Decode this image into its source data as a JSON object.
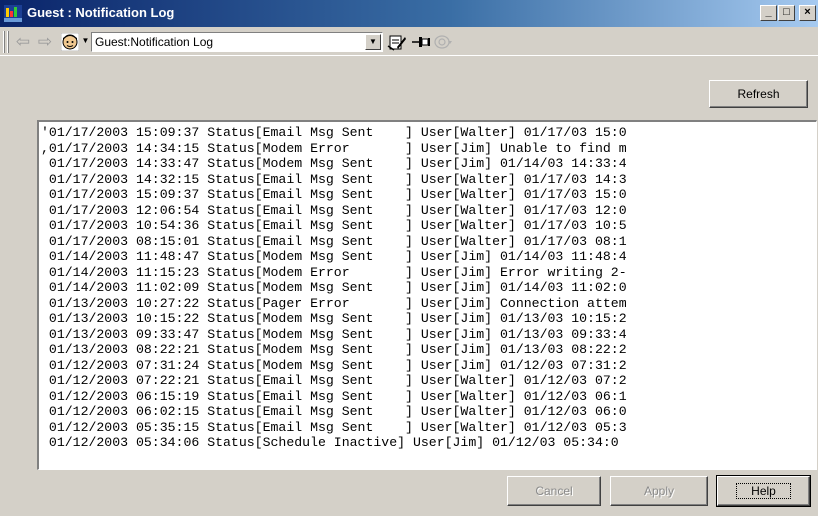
{
  "window": {
    "title": "Guest : Notification Log",
    "minimize_glyph": "_",
    "maximize_glyph": "□",
    "close_glyph": "×"
  },
  "toolbar": {
    "back_icon": "back-arrow-icon",
    "forward_icon": "forward-arrow-icon",
    "address_value": "Guest:Notification Log",
    "back_glyph": "⇦",
    "forward_glyph": "⇨",
    "dropdown_glyph": "▼"
  },
  "actions": {
    "refresh_label": "Refresh",
    "cancel_label": "Cancel",
    "apply_label": "Apply",
    "help_label": "Help"
  },
  "log": {
    "lines": [
      "'01/17/2003 15:09:37 Status[Email Msg Sent    ] User[Walter] 01/17/03 15:0",
      ",01/17/2003 14:34:15 Status[Modem Error       ] User[Jim] Unable to find m",
      " 01/17/2003 14:33:47 Status[Modem Msg Sent    ] User[Jim] 01/14/03 14:33:4",
      " 01/17/2003 14:32:15 Status[Email Msg Sent    ] User[Walter] 01/17/03 14:3",
      " 01/17/2003 15:09:37 Status[Email Msg Sent    ] User[Walter] 01/17/03 15:0",
      " 01/17/2003 12:06:54 Status[Email Msg Sent    ] User[Walter] 01/17/03 12:0",
      " 01/17/2003 10:54:36 Status[Email Msg Sent    ] User[Walter] 01/17/03 10:5",
      " 01/17/2003 08:15:01 Status[Email Msg Sent    ] User[Walter] 01/17/03 08:1",
      " 01/14/2003 11:48:47 Status[Modem Msg Sent    ] User[Jim] 01/14/03 11:48:4",
      " 01/14/2003 11:15:23 Status[Modem Error       ] User[Jim] Error writing 2-",
      " 01/14/2003 11:02:09 Status[Modem Msg Sent    ] User[Jim] 01/14/03 11:02:0",
      " 01/13/2003 10:27:22 Status[Pager Error       ] User[Jim] Connection attem",
      " 01/13/2003 10:15:22 Status[Modem Msg Sent    ] User[Jim] 01/13/03 10:15:2",
      " 01/13/2003 09:33:47 Status[Modem Msg Sent    ] User[Jim] 01/13/03 09:33:4",
      " 01/13/2003 08:22:21 Status[Modem Msg Sent    ] User[Jim] 01/13/03 08:22:2",
      " 01/12/2003 07:31:24 Status[Modem Msg Sent    ] User[Jim] 01/12/03 07:31:2",
      " 01/12/2003 07:22:21 Status[Email Msg Sent    ] User[Walter] 01/12/03 07:2",
      " 01/12/2003 06:15:19 Status[Email Msg Sent    ] User[Walter] 01/12/03 06:1",
      " 01/12/2003 06:02:15 Status[Email Msg Sent    ] User[Walter] 01/12/03 06:0",
      " 01/12/2003 05:35:15 Status[Email Msg Sent    ] User[Walter] 01/12/03 05:3",
      " 01/12/2003 05:34:06 Status[Schedule Inactive] User[Jim] 01/12/03 05:34:0"
    ]
  },
  "colors": {
    "titlebar_start": "#0a246a",
    "titlebar_end": "#a6caf0",
    "face": "#d4d0c8"
  }
}
